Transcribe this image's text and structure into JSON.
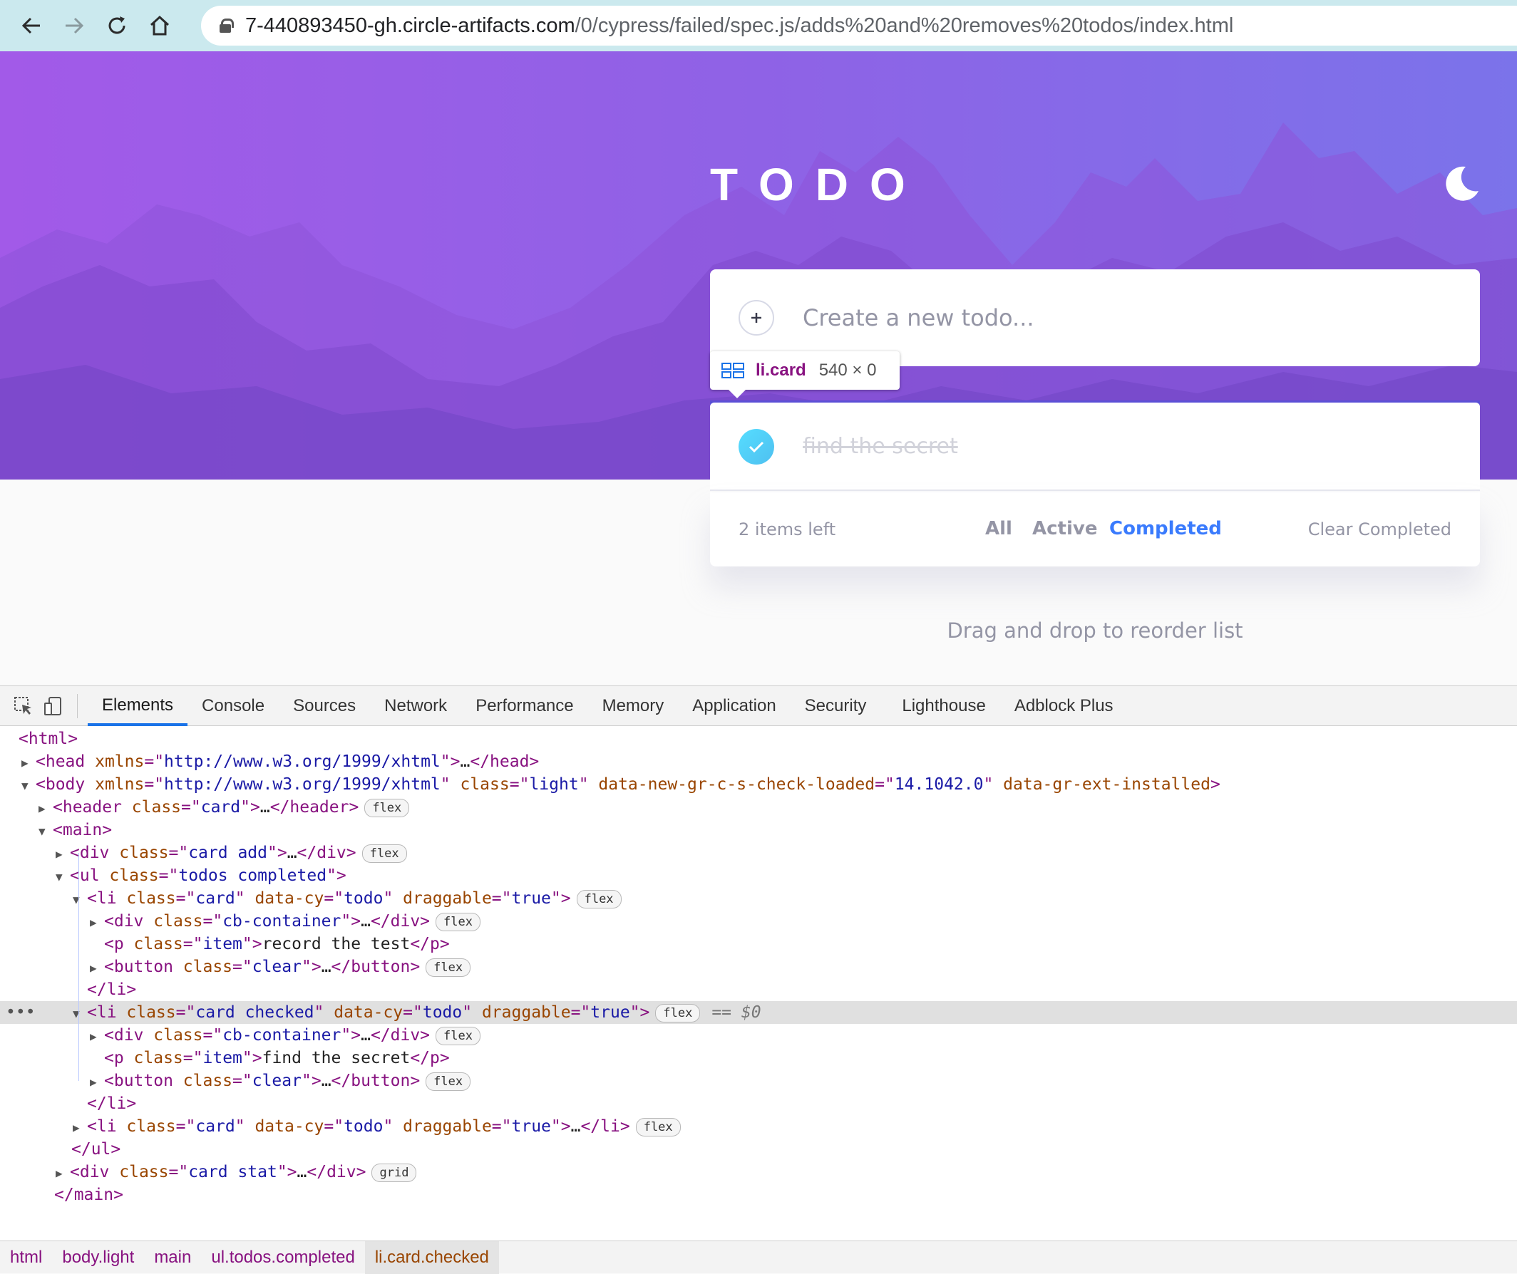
{
  "browser": {
    "back_icon": "arrow-left-icon",
    "forward_icon": "arrow-right-icon",
    "reload_icon": "reload-icon",
    "home_icon": "home-icon",
    "url_host": "7-440893450-gh.circle-artifacts.com",
    "url_path": "/0/cypress/failed/spec.js/adds%20and%20removes%20todos/index.html"
  },
  "app": {
    "title": "TODO",
    "theme_icon": "moon-icon",
    "new_todo_placeholder": "Create a new todo...",
    "add_icon": "plus-icon",
    "todo_item_text": "find the secret",
    "todo_item_completed": true,
    "items_left": "2 items left",
    "filters": {
      "all": "All",
      "active": "Active",
      "completed": "Completed",
      "selected": "Completed"
    },
    "clear_completed": "Clear Completed",
    "footer_hint": "Drag and drop to reorder list",
    "accent_color": "#3a7bfd",
    "check_color": "#55ddff"
  },
  "inspect_tooltip": {
    "icon": "flex-layout-icon",
    "tag": "li.card",
    "size": "540 × 0"
  },
  "devtools": {
    "tabs": [
      "Elements",
      "Console",
      "Sources",
      "Network",
      "Performance",
      "Memory",
      "Application",
      "Security",
      "Lighthouse",
      "Adblock Plus"
    ],
    "active_tab": "Elements",
    "badges": {
      "flex": "flex",
      "grid": "grid"
    },
    "selected_marker": "== $0",
    "breadcrumb": [
      "html",
      "body.light",
      "main",
      "ul.todos.completed",
      "li.card.checked"
    ],
    "dom": {
      "html_open": "<html>",
      "head_xmlns": "http://www.w3.org/1999/xhtml",
      "body_xmlns": "http://www.w3.org/1999/xhtml",
      "body_class": "light",
      "body_gr_loaded": "14.1042.0",
      "header_class": "card",
      "add_div_class": "card add",
      "ul_class": "todos completed",
      "li1_class": "card",
      "li2_class": "card checked",
      "li3_class": "card",
      "data_cy": "todo",
      "draggable": "true",
      "cb_class": "cb-container",
      "p_class": "item",
      "btn_class": "clear",
      "item1_text": "record the test",
      "item2_text": "find the secret",
      "stat_class": "card stat"
    }
  }
}
